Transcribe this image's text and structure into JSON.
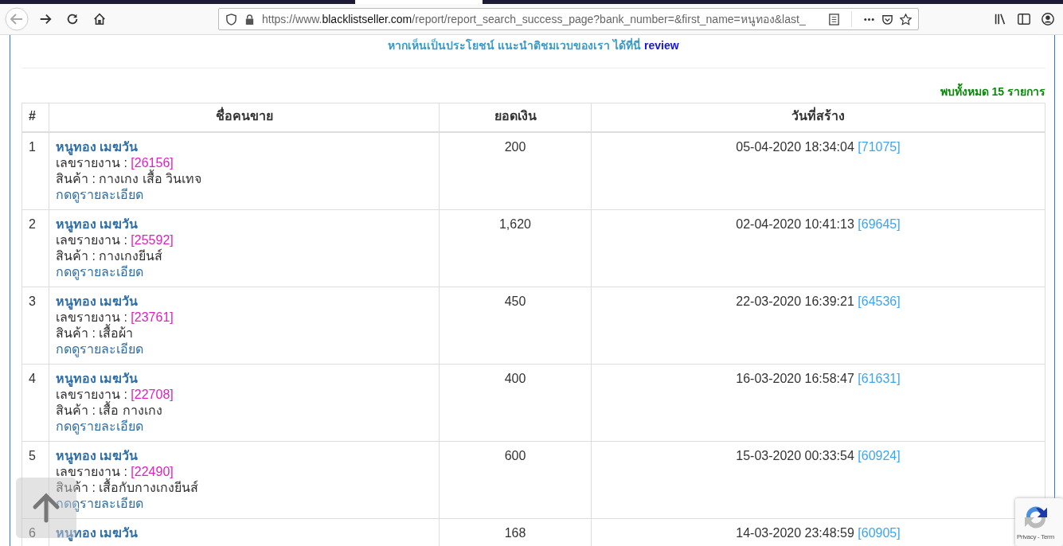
{
  "browser": {
    "url_prefix": "https://www.",
    "url_domain": "blacklistseller.com",
    "url_rest": "/report/report_search_success_page?bank_number=&first_name=หนูทอง&last_"
  },
  "banner": {
    "text": "หากเห็นเป็นประโยชน์ แนะนำติชมเวบของเรา ได้ที่นี่",
    "link": "review"
  },
  "result_count": "พบทั้งหมด **15** รายการ",
  "table": {
    "columns": [
      "#",
      "ชื่อคนขาย",
      "ยอดเงิน",
      "วันที่สร้าง"
    ],
    "rows": [
      {
        "index": "1",
        "seller": "หนูทอง เมฆวัน",
        "report_label": "เลขรายงาน :",
        "report_no": "[26156]",
        "product": "สินค้า : กางเกง เสื้อ วินเทจ",
        "details": "กดดูรายละเอียด",
        "amount": "200",
        "created": "05-04-2020 18:34:04",
        "ref": "[71075]"
      },
      {
        "index": "2",
        "seller": "หนูทอง เมฆวัน",
        "report_label": "เลขรายงาน :",
        "report_no": "[25592]",
        "product": "สินค้า : กางเกงยีนส์",
        "details": "กดดูรายละเอียด",
        "amount": "1,620",
        "created": "02-04-2020 10:41:13",
        "ref": "[69645]"
      },
      {
        "index": "3",
        "seller": "หนูทอง เมฆวัน",
        "report_label": "เลขรายงาน :",
        "report_no": "[23761]",
        "product": "สินค้า : เสื้อผ้า",
        "details": "กดดูรายละเอียด",
        "amount": "450",
        "created": "22-03-2020 16:39:21",
        "ref": "[64536]"
      },
      {
        "index": "4",
        "seller": "หนูทอง เมฆวัน",
        "report_label": "เลขรายงาน :",
        "report_no": "[22708]",
        "product": "สินค้า : เสื้อ กางเกง",
        "details": "กดดูรายละเอียด",
        "amount": "400",
        "created": "16-03-2020 16:58:47",
        "ref": "[61631]"
      },
      {
        "index": "5",
        "seller": "หนูทอง เมฆวัน",
        "report_label": "เลขรายงาน :",
        "report_no": "[22490]",
        "product": "สินค้า : เสื้อกับกางเกงยีนส์",
        "details": "กดดูรายละเอียด",
        "amount": "600",
        "created": "15-03-2020 00:33:54",
        "ref": "[60924]"
      },
      {
        "index": "6",
        "seller": "หนูทอง เมฆวัน",
        "amount": "168",
        "created": "14-03-2020 23:48:59",
        "ref": "[60905]"
      }
    ]
  },
  "recaptcha": {
    "links": "Privacy - Term"
  }
}
